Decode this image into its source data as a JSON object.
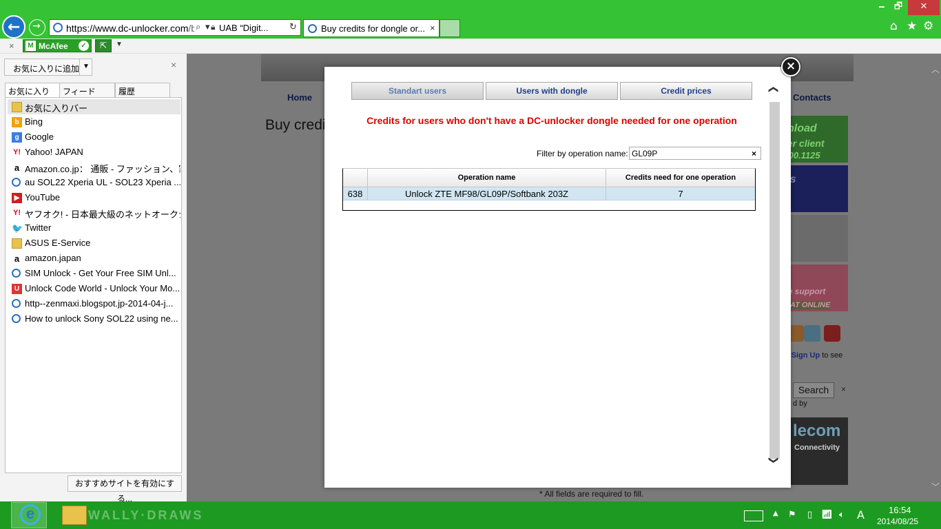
{
  "browser": {
    "url_main": "https://www.dc-unlocker.com",
    "url_rest": "/b",
    "cert_name": "UAB “Digit...",
    "active_tab_title": "Buy credits for dongle or...",
    "tab_close": "×",
    "win_min": "🗕",
    "win_max": "🗗",
    "win_close": "✕"
  },
  "toolbar": {
    "close": "×",
    "mcafee_label": "McAfee",
    "mcafee_mark": "M",
    "mcafee_ok": "✓",
    "share": "⇱",
    "dropdown": "▼"
  },
  "favorites": {
    "add_button": "お気に入りに追加",
    "add_dropdown": "▼",
    "close": "×",
    "tabs": [
      "お気に入り",
      "フィード",
      "履歴"
    ],
    "items": [
      {
        "label": "お気に入りバー",
        "icon": "folder-icon",
        "glyph": ""
      },
      {
        "label": "Bing",
        "icon": "bing-icon",
        "glyph": "b"
      },
      {
        "label": "Google",
        "icon": "google-icon",
        "glyph": "g"
      },
      {
        "label": "Yahoo! JAPAN",
        "icon": "yahoo-icon",
        "glyph": "Y!"
      },
      {
        "label": "Amazon.co.jp： 通販 - ファッション、家電...",
        "icon": "amazon-icon",
        "glyph": "a"
      },
      {
        "label": "au SOL22 Xperia UL - SOL23 Xperia ...",
        "icon": "ie-icon",
        "glyph": ""
      },
      {
        "label": "YouTube",
        "icon": "youtube-icon",
        "glyph": "▶"
      },
      {
        "label": "ヤフオク! - 日本最大級のネットオークションサ...",
        "icon": "yahoo-icon",
        "glyph": "Y!"
      },
      {
        "label": "Twitter",
        "icon": "twitter-icon",
        "glyph": "🐦"
      },
      {
        "label": "ASUS E-Service",
        "icon": "folder-icon",
        "glyph": ""
      },
      {
        "label": "amazon.japan",
        "icon": "amazon-icon",
        "glyph": "a"
      },
      {
        "label": "SIM Unlock - Get Your Free SIM Unl...",
        "icon": "ie-icon",
        "glyph": ""
      },
      {
        "label": "Unlock Code World - Unlock Your Mo...",
        "icon": "ucw-icon",
        "glyph": "U"
      },
      {
        "label": "http--zenmaxi.blogspot.jp-2014-04-j...",
        "icon": "ie-icon",
        "glyph": ""
      },
      {
        "label": "How to unlock Sony SOL22 using ne...",
        "icon": "ie-icon",
        "glyph": ""
      }
    ],
    "suggest_button": "おすすめサイトを有効にする..."
  },
  "page": {
    "nav_home": "Home",
    "nav_contacts": "Contacts",
    "heading": "Buy credi",
    "side_text_1": "nload",
    "side_text_2": "ker client",
    "side_text_3": ".00.1125",
    "side_text_4": "its",
    "side_text_5": "s",
    "side_text_6": "?",
    "side_text_7": "ve support",
    "side_text_8": "HAT ONLINE",
    "signup_pre": "s.",
    "signup_link": "Sign Up",
    "signup_post": "to see",
    "search_button": "Search",
    "search_close": "×",
    "by_label": "d by",
    "telecom_big": "lecom",
    "telecom_small": "Connectivity",
    "fields_note": "* All fields are required to fill."
  },
  "modal": {
    "close": "×",
    "tabs": [
      {
        "label": "Standart users",
        "active": true
      },
      {
        "label": "Users with dongle",
        "active": false
      },
      {
        "label": "Credit prices",
        "active": false
      }
    ],
    "title": "Credits for users who don't have a DC-unlocker dongle needed for one operation",
    "filter_label": "Filter by operation name:",
    "filter_value": "GL09P",
    "filter_clear": "×",
    "grid": {
      "columns": [
        "",
        "Operation name",
        "Credits need for one operation"
      ],
      "rows": [
        [
          "638",
          "Unlock ZTE MF98/GL09P/Softbank 203Z",
          "7"
        ]
      ]
    },
    "scroll_up": "❮",
    "scroll_down": "❯"
  },
  "taskbar": {
    "watermark": "WALLY·DRAWS",
    "time": "16:54",
    "date": "2014/08/25",
    "ime": "A"
  },
  "colors": {
    "accent": "#36c235",
    "taskbar": "#1d9a21",
    "title_red": "#e00000",
    "link_blue": "#1f3d8a"
  }
}
